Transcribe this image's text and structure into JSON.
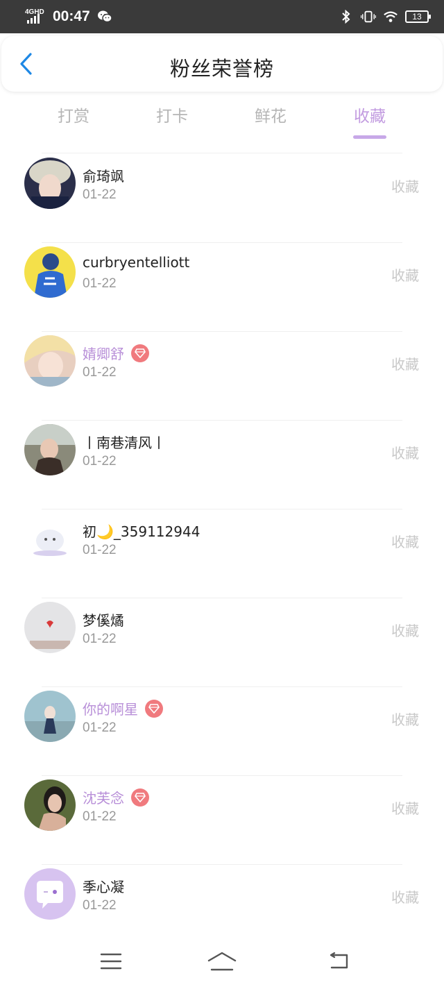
{
  "status_bar": {
    "network": "4GHD",
    "time": "00:47",
    "battery": "13"
  },
  "header": {
    "title": "粉丝荣誉榜"
  },
  "tabs": [
    {
      "label": "打赏"
    },
    {
      "label": "打卡"
    },
    {
      "label": "鲜花"
    },
    {
      "label": "收藏"
    }
  ],
  "active_tab": "收藏",
  "fans": [
    {
      "name": "俞琦飒",
      "date": "01-22",
      "action": "收藏",
      "vip": false
    },
    {
      "name": "curbryentelliott",
      "date": "01-22",
      "action": "收藏",
      "vip": false
    },
    {
      "name": "婧卿舒",
      "date": "01-22",
      "action": "收藏",
      "vip": true
    },
    {
      "name": "丨南巷清风丨",
      "date": "01-22",
      "action": "收藏",
      "vip": false
    },
    {
      "name": "初🌙_359112944",
      "date": "01-22",
      "action": "收藏",
      "vip": false
    },
    {
      "name": "梦傒燏",
      "date": "01-22",
      "action": "收藏",
      "vip": false
    },
    {
      "name": "你的啊星",
      "date": "01-22",
      "action": "收藏",
      "vip": true
    },
    {
      "name": "沈芙念",
      "date": "01-22",
      "action": "收藏",
      "vip": true
    },
    {
      "name": "季心凝",
      "date": "01-22",
      "action": "收藏",
      "vip": false
    }
  ],
  "colors": {
    "accent": "#c29be0",
    "vip_name": "#b88fd8",
    "vip_badge": "#f07a7e",
    "back_arrow": "#1e88e5",
    "status_bar_bg": "#3a3a3a"
  },
  "icons": {
    "back": "chevron-left-icon",
    "vip": "diamond-icon",
    "nav_menu": "menu-icon",
    "nav_home": "home-icon",
    "nav_back": "return-icon"
  }
}
